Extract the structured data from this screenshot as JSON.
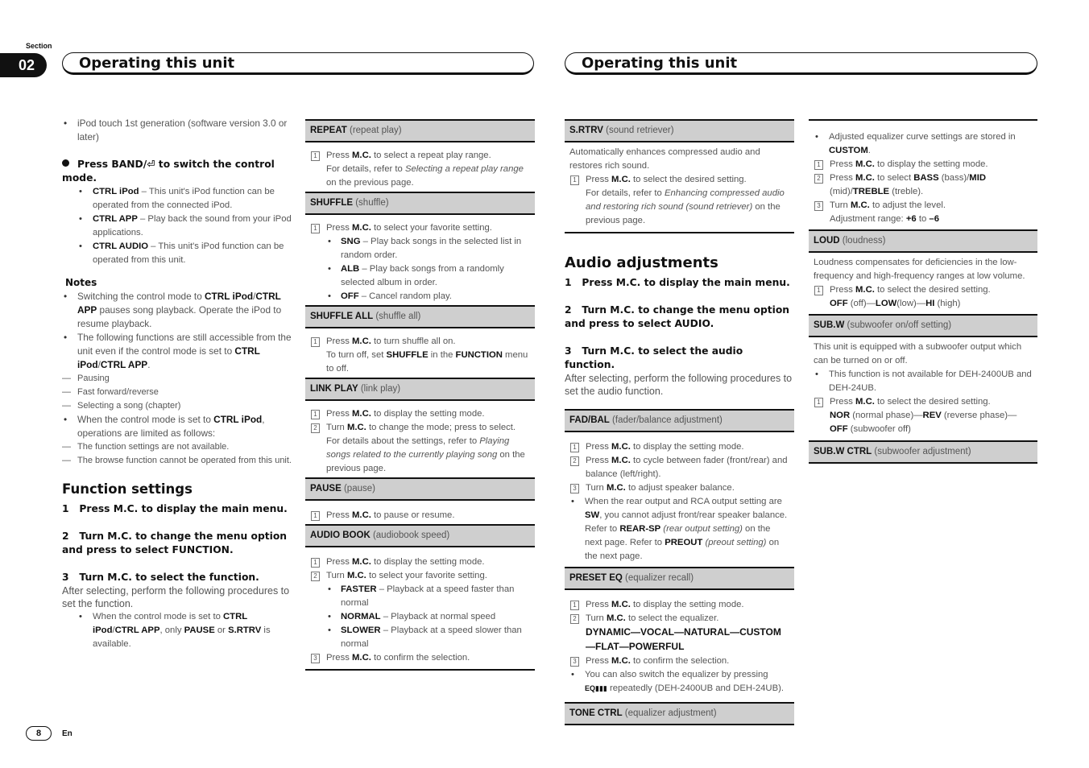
{
  "header": {
    "section_label": "Section",
    "section_number": "02",
    "left_title": "Operating this unit",
    "right_title": "Operating this unit"
  },
  "footer": {
    "page_number": "8",
    "language": "En"
  },
  "col1": {
    "ipod_item": "iPod touch 1st generation (software version 3.0 or later)",
    "press_band_pre": "Press BAND/",
    "press_band_icon": "⏎",
    "press_band_post": " to switch the control mode.",
    "modes": [
      {
        "term": "CTRL iPod",
        "desc": " – This unit's iPod function can be operated from the connected iPod."
      },
      {
        "term": "CTRL APP",
        "desc": " – Play back the sound from your iPod applications."
      },
      {
        "term": "CTRL AUDIO",
        "desc": " – This unit's iPod function can be operated from this unit."
      }
    ],
    "notes_title": "Notes",
    "note1": {
      "pre": "Switching the control mode to ",
      "b1": "CTRL iPod",
      "mid": "/",
      "b2": "CTRL APP",
      "post": " pauses song playback. Operate the iPod to resume playback."
    },
    "note2": {
      "pre": "The following functions are still accessible from the unit even if the control mode is set to ",
      "b1": "CTRL iPod",
      "mid": "/",
      "b2": "CTRL APP",
      "post": "."
    },
    "note2_items": [
      "Pausing",
      "Fast forward/reverse",
      "Selecting a song (chapter)"
    ],
    "note3": {
      "pre": "When the control mode is set to ",
      "b1": "CTRL iPod",
      "post": ", operations are limited as follows:"
    },
    "note3_items": [
      "The function settings are not available.",
      "The browse function cannot be operated from this unit."
    ],
    "function_settings_title": "Function settings",
    "steps": [
      {
        "n": "1",
        "text": "Press M.C. to display the main menu."
      },
      {
        "n": "2",
        "text": "Turn M.C. to change the menu option and press to select FUNCTION."
      },
      {
        "n": "3",
        "text": "Turn M.C. to select the function."
      }
    ],
    "after_selecting": "After selecting, perform the following procedures to set the function.",
    "fs_note": {
      "pre": "When the control mode is set to ",
      "b1": "CTRL iPod",
      "mid": "/",
      "b2": "CTRL APP",
      "m2": ", only ",
      "b3": "PAUSE",
      "m3": " or ",
      "b4": "S.RTRV",
      "post": " is available."
    }
  },
  "col2": {
    "repeat": {
      "term": "REPEAT",
      "desc": " (repeat play)",
      "s1_pre": "Press ",
      "s1_b": "M.C.",
      "s1_post": " to select a repeat play range.",
      "s1_more_pre": "For details, refer to ",
      "s1_more_i": "Selecting a repeat play range",
      "s1_more_post": " on the previous page."
    },
    "shuffle": {
      "term": "SHUFFLE",
      "desc": " (shuffle)",
      "s1_pre": "Press ",
      "s1_b": "M.C.",
      "s1_post": " to select your favorite setting.",
      "options": [
        {
          "term": "SNG",
          "desc": " – Play back songs in the selected list in random order."
        },
        {
          "term": "ALB",
          "desc": " – Play back songs from a randomly selected album in order."
        },
        {
          "term": "OFF",
          "desc": " – Cancel random play."
        }
      ]
    },
    "shuffle_all": {
      "term": "SHUFFLE ALL",
      "desc": " (shuffle all)",
      "s1_pre": "Press ",
      "s1_b": "M.C.",
      "s1_post": " to turn shuffle all on.",
      "more_pre": "To turn off, set ",
      "more_b1": "SHUFFLE",
      "more_mid": " in the ",
      "more_b2": "FUNCTION",
      "more_post": " menu to off."
    },
    "link_play": {
      "term": "LINK PLAY",
      "desc": " (link play)",
      "s1_pre": "Press ",
      "s1_b": "M.C.",
      "s1_post": " to display the setting mode.",
      "s2_pre": "Turn ",
      "s2_b": "M.C.",
      "s2_post": " to change the mode; press to select.",
      "more_pre": "For details about the settings, refer to ",
      "more_i": "Playing songs related to the currently playing song",
      "more_post": " on the previous page."
    },
    "pause": {
      "term": "PAUSE",
      "desc": " (pause)",
      "s1_pre": "Press ",
      "s1_b": "M.C.",
      "s1_post": " to pause or resume."
    },
    "audio_book": {
      "term": "AUDIO BOOK",
      "desc": " (audiobook speed)",
      "s1_pre": "Press ",
      "s1_b": "M.C.",
      "s1_post": " to display the setting mode.",
      "s2_pre": "Turn ",
      "s2_b": "M.C.",
      "s2_post": " to select your favorite setting.",
      "options": [
        {
          "term": "FASTER",
          "desc": " – Playback at a speed faster than normal"
        },
        {
          "term": "NORMAL",
          "desc": " – Playback at normal speed"
        },
        {
          "term": "SLOWER",
          "desc": " – Playback at a speed slower than normal"
        }
      ],
      "s3_pre": "Press ",
      "s3_b": "M.C.",
      "s3_post": " to confirm the selection."
    }
  },
  "col3": {
    "srtrv": {
      "term": "S.RTRV",
      "desc": " (sound retriever)",
      "intro": "Automatically enhances compressed audio and restores rich sound.",
      "s1_pre": "Press ",
      "s1_b": "M.C.",
      "s1_post": " to select the desired setting.",
      "more_pre": "For details, refer to ",
      "more_i": "Enhancing compressed audio and restoring rich sound (sound retriever)",
      "more_post": " on the previous page."
    },
    "audio_title": "Audio adjustments",
    "steps": [
      {
        "n": "1",
        "text": "Press M.C. to display the main menu."
      },
      {
        "n": "2",
        "text": "Turn M.C. to change the menu option and press to select AUDIO."
      },
      {
        "n": "3",
        "text": "Turn M.C. to select the audio function."
      }
    ],
    "after_selecting": "After selecting, perform the following procedures to set the audio function.",
    "fad_bal": {
      "term": "FAD/BAL",
      "desc": " (fader/balance adjustment)",
      "s1_pre": "Press ",
      "s1_b": "M.C.",
      "s1_post": " to display the setting mode.",
      "s2_pre": "Press ",
      "s2_b": "M.C.",
      "s2_post": " to cycle between fader (front/rear) and balance (left/right).",
      "s3_pre": "Turn ",
      "s3_b": "M.C.",
      "s3_post": " to adjust speaker balance.",
      "note_pre": "When the rear output and RCA output setting are ",
      "note_b1": "SW",
      "note_m1": ", you cannot adjust front/rear speaker balance. Refer to ",
      "note_b2": "REAR-SP",
      "note_i1": " (rear output setting)",
      "note_m2": " on the next page. Refer to ",
      "note_b3": "PREOUT",
      "note_i2": " (preout setting)",
      "note_post": " on the next page."
    },
    "preset_eq": {
      "term": "PRESET EQ",
      "desc": " (equalizer recall)",
      "s1_pre": "Press ",
      "s1_b": "M.C.",
      "s1_post": " to display the setting mode.",
      "s2_pre": "Turn ",
      "s2_b": "M.C.",
      "s2_post": " to select the equalizer.",
      "eq_list": "DYNAMIC—VOCAL—NATURAL—CUSTOM—FLAT—POWERFUL",
      "s3_pre": "Press ",
      "s3_b": "M.C.",
      "s3_post": " to confirm the selection.",
      "note_pre": "You can also switch the equalizer by pressing ",
      "note_icon": "EQ",
      "note_post": " repeatedly (DEH-2400UB and DEH-24UB)."
    },
    "tone_ctrl": {
      "term": "TONE CTRL",
      "desc": " (equalizer adjustment)"
    }
  },
  "col4": {
    "tone_cont": {
      "note_pre": "Adjusted equalizer curve settings are stored in ",
      "note_b": "CUSTOM",
      "note_post": ".",
      "s1_pre": "Press ",
      "s1_b": "M.C.",
      "s1_post": " to display the setting mode.",
      "s2_pre": "Press ",
      "s2_b": "M.C.",
      "s2_m1": " to select ",
      "s2_b1": "BASS",
      "s2_m2": " (bass)/",
      "s2_b2": "MID",
      "s2_m3": " (mid)/",
      "s2_b3": "TREBLE",
      "s2_post": " (treble).",
      "s3_pre": "Turn ",
      "s3_b": "M.C.",
      "s3_post": " to adjust the level.",
      "range_pre": "Adjustment range: ",
      "range_b1": "+6",
      "range_mid": " to ",
      "range_b2": "–6"
    },
    "loud": {
      "term": "LOUD",
      "desc": " (loudness)",
      "intro": "Loudness compensates for deficiencies in the low-frequency and high-frequency ranges at low volume.",
      "s1_pre": "Press ",
      "s1_b": "M.C.",
      "s1_post": " to select the desired setting.",
      "o1": "OFF",
      "o1d": " (off)—",
      "o2": "LOW",
      "o2d": "(low)—",
      "o3": "HI",
      "o3d": " (high)"
    },
    "subw": {
      "term": "SUB.W",
      "desc": " (subwoofer on/off setting)",
      "intro": "This unit is equipped with a subwoofer output which can be turned on or off.",
      "note": "This function is not available for DEH-2400UB and DEH-24UB.",
      "s1_pre": "Press ",
      "s1_b": "M.C.",
      "s1_post": " to select the desired setting.",
      "o1": "NOR",
      "o1d": " (normal phase)—",
      "o2": "REV",
      "o2d": " (reverse phase)—",
      "o3": "OFF",
      "o3d": " (subwoofer off)"
    },
    "subw_ctrl": {
      "term": "SUB.W CTRL",
      "desc": " (subwoofer adjustment)"
    }
  }
}
